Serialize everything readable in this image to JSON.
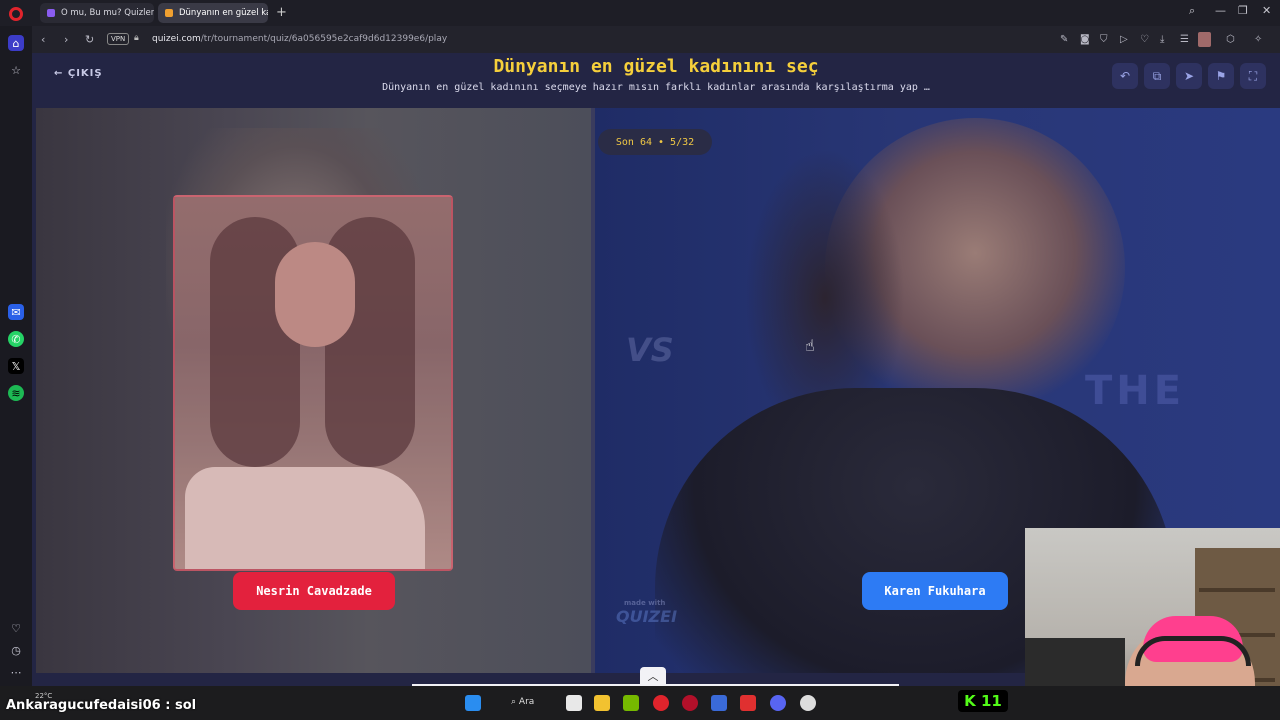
{
  "browser": {
    "tabs": [
      {
        "label": "O mu, Bu mu? Quizleri | T"
      },
      {
        "label": "Dünyanın en güzel kadını"
      }
    ],
    "vpn_label": "VPN",
    "url_host": "quizei.com",
    "url_path": "/tr/tournament/quiz/6a056595e2caf9d6d12399e6/play"
  },
  "page": {
    "exit_label": "ÇIKIŞ",
    "title": "Dünyanın en güzel kadınını seç",
    "subtitle": "Dünyanın en güzel kadınını seçmeye hazır mısın farklı kadınlar arasında karşılaştırma yap …",
    "progress": "Son 64 • 5/32",
    "vs_label": "VS",
    "left_choice": "Nesrin Cavadzade",
    "right_choice": "Karen Fukuhara",
    "watermark_small": "made with",
    "watermark_brand": "QUIZEI",
    "right_bg_text": "THE"
  },
  "overlay": {
    "chat_message": "Ankaragucufedaisi06 : sol",
    "temperature": "22°C",
    "kick_count": "11"
  },
  "taskbar": {
    "search_label": "Ara"
  },
  "colors": {
    "accent_yellow": "#f5cf3b",
    "left_button": "#e3213d",
    "right_button": "#2d7bf4",
    "page_bg": "#232544"
  }
}
